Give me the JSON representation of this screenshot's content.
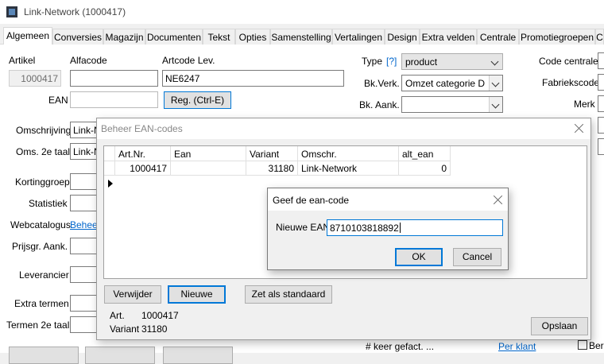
{
  "window": {
    "title": "Link-Network (1000417)"
  },
  "tabs": [
    "Algemeen",
    "Conversies",
    "Magazijn",
    "Documenten",
    "Tekst",
    "Opties",
    "Samenstelling",
    "Vertalingen",
    "Design",
    "Extra velden",
    "Centrale",
    "Promotiegroepen",
    "C"
  ],
  "form": {
    "artikel_label": "Artikel",
    "artikel_value": "1000417",
    "alfacode_label": "Alfacode",
    "alfacode_value": "",
    "artcode_label": "Artcode Lev.",
    "artcode_value": "NE6247",
    "ean_label": "EAN",
    "ean_value": "",
    "reg_button": "Reg.  (Ctrl-E)",
    "omschrijving_label": "Omschrijving",
    "omschrijving_value": "Link-Ne",
    "oms2_label": "Oms. 2e taal",
    "oms2_value": "Link-Ne",
    "kortinggroep_label": "Kortinggroep",
    "statistiek_label": "Statistiek",
    "webcatalogus_label": "Webcatalogus",
    "webcatalogus_link": "Beheer",
    "prijsgr_label": "Prijsgr. Aank.",
    "leverancier_label": "Leverancier",
    "extra_termen_label": "Extra termen",
    "termen2_label": "Termen 2e taal",
    "type_label": "Type",
    "type_help": "[?]",
    "type_value": "product",
    "bkverk_label": "Bk.Verk.",
    "bkverk_value": "Omzet categorie D",
    "bkaank_label": "Bk. Aank.",
    "bkaank_value": "",
    "code_centrale_label": "Code centrale",
    "fabriekscode_label": "Fabriekscode",
    "merk_label": "Merk",
    "keer_gefact": "# keer gefact.  ...",
    "per_klant_link": "Per klant",
    "bere_label": "Bere"
  },
  "dialog_ean": {
    "title": "Beheer EAN-codes",
    "columns": [
      "Art.Nr.",
      "Ean",
      "Variant",
      "Omschr.",
      "alt_ean"
    ],
    "rows": [
      {
        "artnr": "1000417",
        "ean": "",
        "variant": "31180",
        "omschr": "Link-Network",
        "alt_ean": "0"
      }
    ],
    "buttons": {
      "delete": "Verwijder",
      "new": "Nieuwe",
      "default": "Zet als standaard",
      "save": "Opslaan"
    },
    "footer": {
      "art_label": "Art.",
      "art_value": "1000417",
      "variant_label": "Variant",
      "variant_value": "31180"
    }
  },
  "dialog_new_ean": {
    "title": "Geef de ean-code",
    "label": "Nieuwe EAN",
    "value": "8710103818892",
    "ok": "OK",
    "cancel": "Cancel"
  }
}
